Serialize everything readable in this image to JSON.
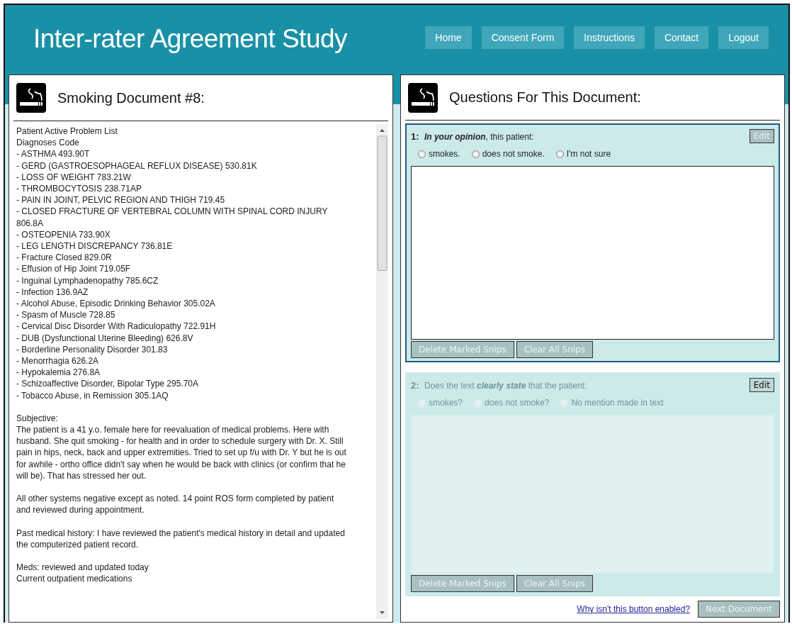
{
  "site_title": "Inter-rater Agreement Study",
  "nav": [
    {
      "label": "Home"
    },
    {
      "label": "Consent Form"
    },
    {
      "label": "Instructions"
    },
    {
      "label": "Contact"
    },
    {
      "label": "Logout"
    }
  ],
  "document_panel": {
    "title": "Smoking Document #8:",
    "blocks": [
      [
        "Patient Active Problem List",
        "Diagnoses Code",
        "- ASTHMA 493.90T",
        "- GERD (GASTROESOPHAGEAL REFLUX DISEASE) 530.81K",
        "- LOSS OF WEIGHT 783.21W",
        "- THROMBOCYTOSIS 238.71AP",
        "- PAIN IN JOINT, PELVIC REGION AND THIGH 719.45",
        "- CLOSED FRACTURE OF VERTEBRAL COLUMN WITH SPINAL CORD INJURY 806.8A",
        "- OSTEOPENIA 733.90X",
        "- LEG LENGTH DISCREPANCY 736.81E",
        "- Fracture Closed 829.0R",
        "- Effusion of Hip Joint 719.05F",
        "- Inguinal Lymphadenopathy 785.6CZ",
        "- Infection 136.9AZ",
        "- Alcohol Abuse, Episodic Drinking Behavior 305.02A",
        "- Spasm of Muscle 728.85",
        "- Cervical Disc Disorder With Radiculopathy 722.91H",
        "- DUB (Dysfunctional Uterine Bleeding) 626.8V",
        "- Borderline Personality Disorder 301.83",
        "- Menorrhagia 626.2A",
        "- Hypokalemia 276.8A",
        "- Schizoaffective Disorder, Bipolar Type 295.70A",
        "- Tobacco Abuse, in Remission 305.1AQ"
      ],
      [
        "Subjective:",
        "The patient is a 41 y.o. female here for reevaluation of medical problems. Here with husband. She quit smoking - for health and in order to schedule surgery with Dr. X. Still pain in hips, neck, back and upper extremities. Tried to set up f/u with Dr. Y but he is out for awhile - ortho office didn't say when he would be back with clinics (or confirm that he will be). That has stressed her out."
      ],
      [
        "All other systems negative except as noted. 14 point ROS form completed by patient and reviewed during appointment."
      ],
      [
        "Past medical history: I have reviewed the patient's medical history in detail and updated the computerized patient record."
      ],
      [
        "Meds: reviewed and updated today",
        "Current outpatient medications"
      ]
    ]
  },
  "questions_panel": {
    "title": "Questions For This Document:",
    "questions": [
      {
        "number": "1:",
        "text": "**In your opinion**, this patient:",
        "disabled": false,
        "edit_button": {
          "label": "Edit",
          "disabled": true
        },
        "options": [
          {
            "label": "smokes.",
            "selected": false
          },
          {
            "label": "does not smoke.",
            "selected": false
          },
          {
            "label": "I'm not sure",
            "selected": false
          }
        ],
        "buttons": [
          {
            "label": "Delete Marked Snips",
            "disabled": true
          },
          {
            "label": "Clear All Snips",
            "disabled": true
          }
        ]
      },
      {
        "number": "2:",
        "text": "Does the text **clearly state** that the patient:",
        "disabled": true,
        "edit_button": {
          "label": "Edit",
          "disabled": false
        },
        "options": [
          {
            "label": "smokes?",
            "selected": false
          },
          {
            "label": "does not smoke?",
            "selected": false
          },
          {
            "label": "No mention made in text",
            "selected": false
          }
        ],
        "buttons": [
          {
            "label": "Delete Marked Snips",
            "disabled": true
          },
          {
            "label": "Clear All Snips",
            "disabled": true
          }
        ]
      }
    ],
    "help_link": "Why isn't this button enabled?",
    "next_button": {
      "label": "Next Document",
      "disabled": true
    }
  }
}
